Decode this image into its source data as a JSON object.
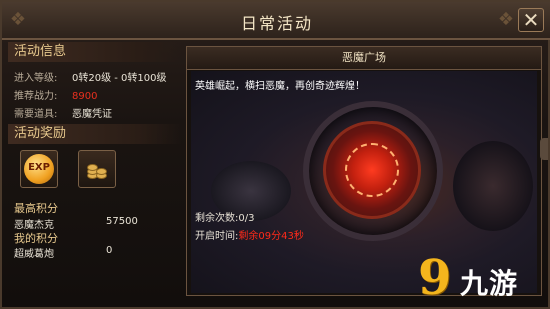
{
  "window": {
    "title": "日常活动"
  },
  "left": {
    "info_header": "活动信息",
    "info": [
      {
        "label": "进入等级:",
        "value": "0转20级 - 0转100级",
        "color": "#e9e3d6"
      },
      {
        "label": "推荐战力:",
        "value": "8900",
        "color": "#e8301f"
      },
      {
        "label": "需要道具:",
        "value": "恶魔凭证",
        "color": "#e9e3d6"
      }
    ],
    "reward_header": "活动奖励",
    "rewards": [
      {
        "icon": "exp-icon",
        "text": "EXP"
      },
      {
        "icon": "gold-coins-icon"
      }
    ],
    "best_score_label": "最高积分",
    "best_score": {
      "name": "恶魔杰克",
      "value": "57500"
    },
    "my_score_label": "我的积分",
    "my_score": {
      "name": "超威葛炮",
      "value": "0"
    }
  },
  "arena": {
    "title": "恶魔广场",
    "flavor": "英雄崛起，横扫恶魔，再创奇迹辉煌！",
    "tries": "剩余次数:0/3",
    "open_label": "开启时间:",
    "open_value": "剩余09分43秒"
  },
  "watermark": {
    "nine": "9",
    "text": "九游"
  },
  "colors": {
    "accent_red": "#e8301f",
    "gold": "#e8c98e"
  }
}
